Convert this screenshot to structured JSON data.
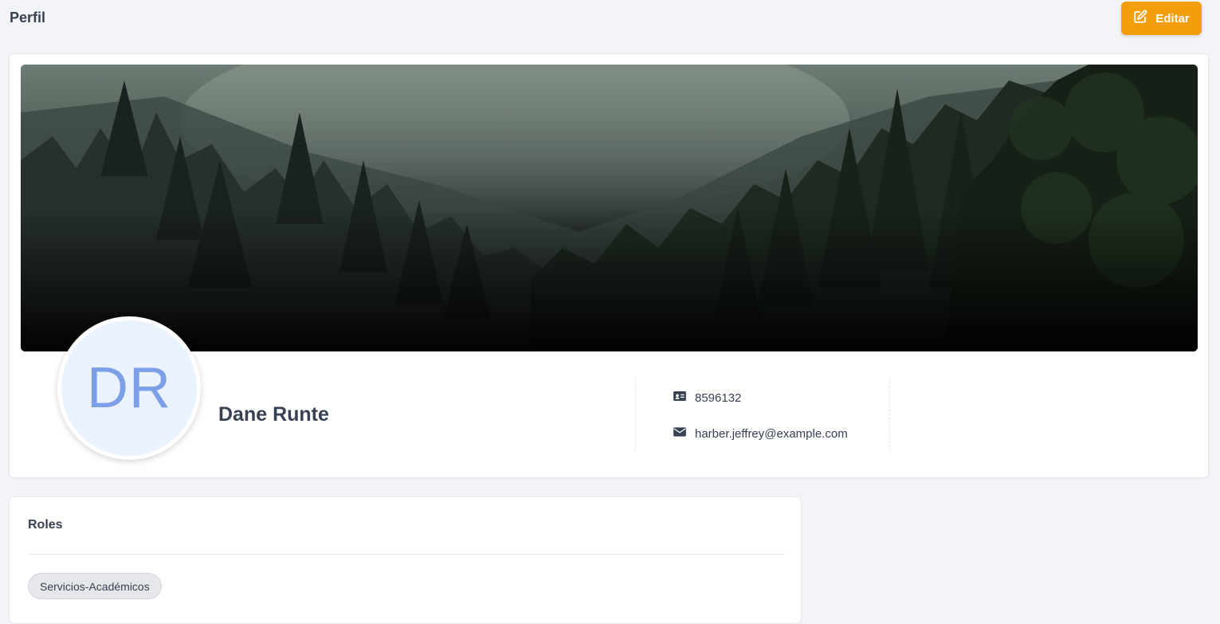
{
  "header": {
    "title": "Perfil",
    "edit_label": "Editar",
    "edit_icon": "edit-icon"
  },
  "profile": {
    "cover_image": "forest-mist-landscape",
    "initials": "DR",
    "name": "Dane Runte",
    "id_number": "8596132",
    "email": "harber.jeffrey@example.com",
    "id_icon": "id-card-icon",
    "email_icon": "envelope-icon"
  },
  "roles": {
    "title": "Roles",
    "items": [
      "Servicios-Académicos"
    ]
  },
  "colors": {
    "accent": "#f59e0b",
    "avatar_bg": "#eaf2fe",
    "avatar_text": "#7d9fe8"
  }
}
